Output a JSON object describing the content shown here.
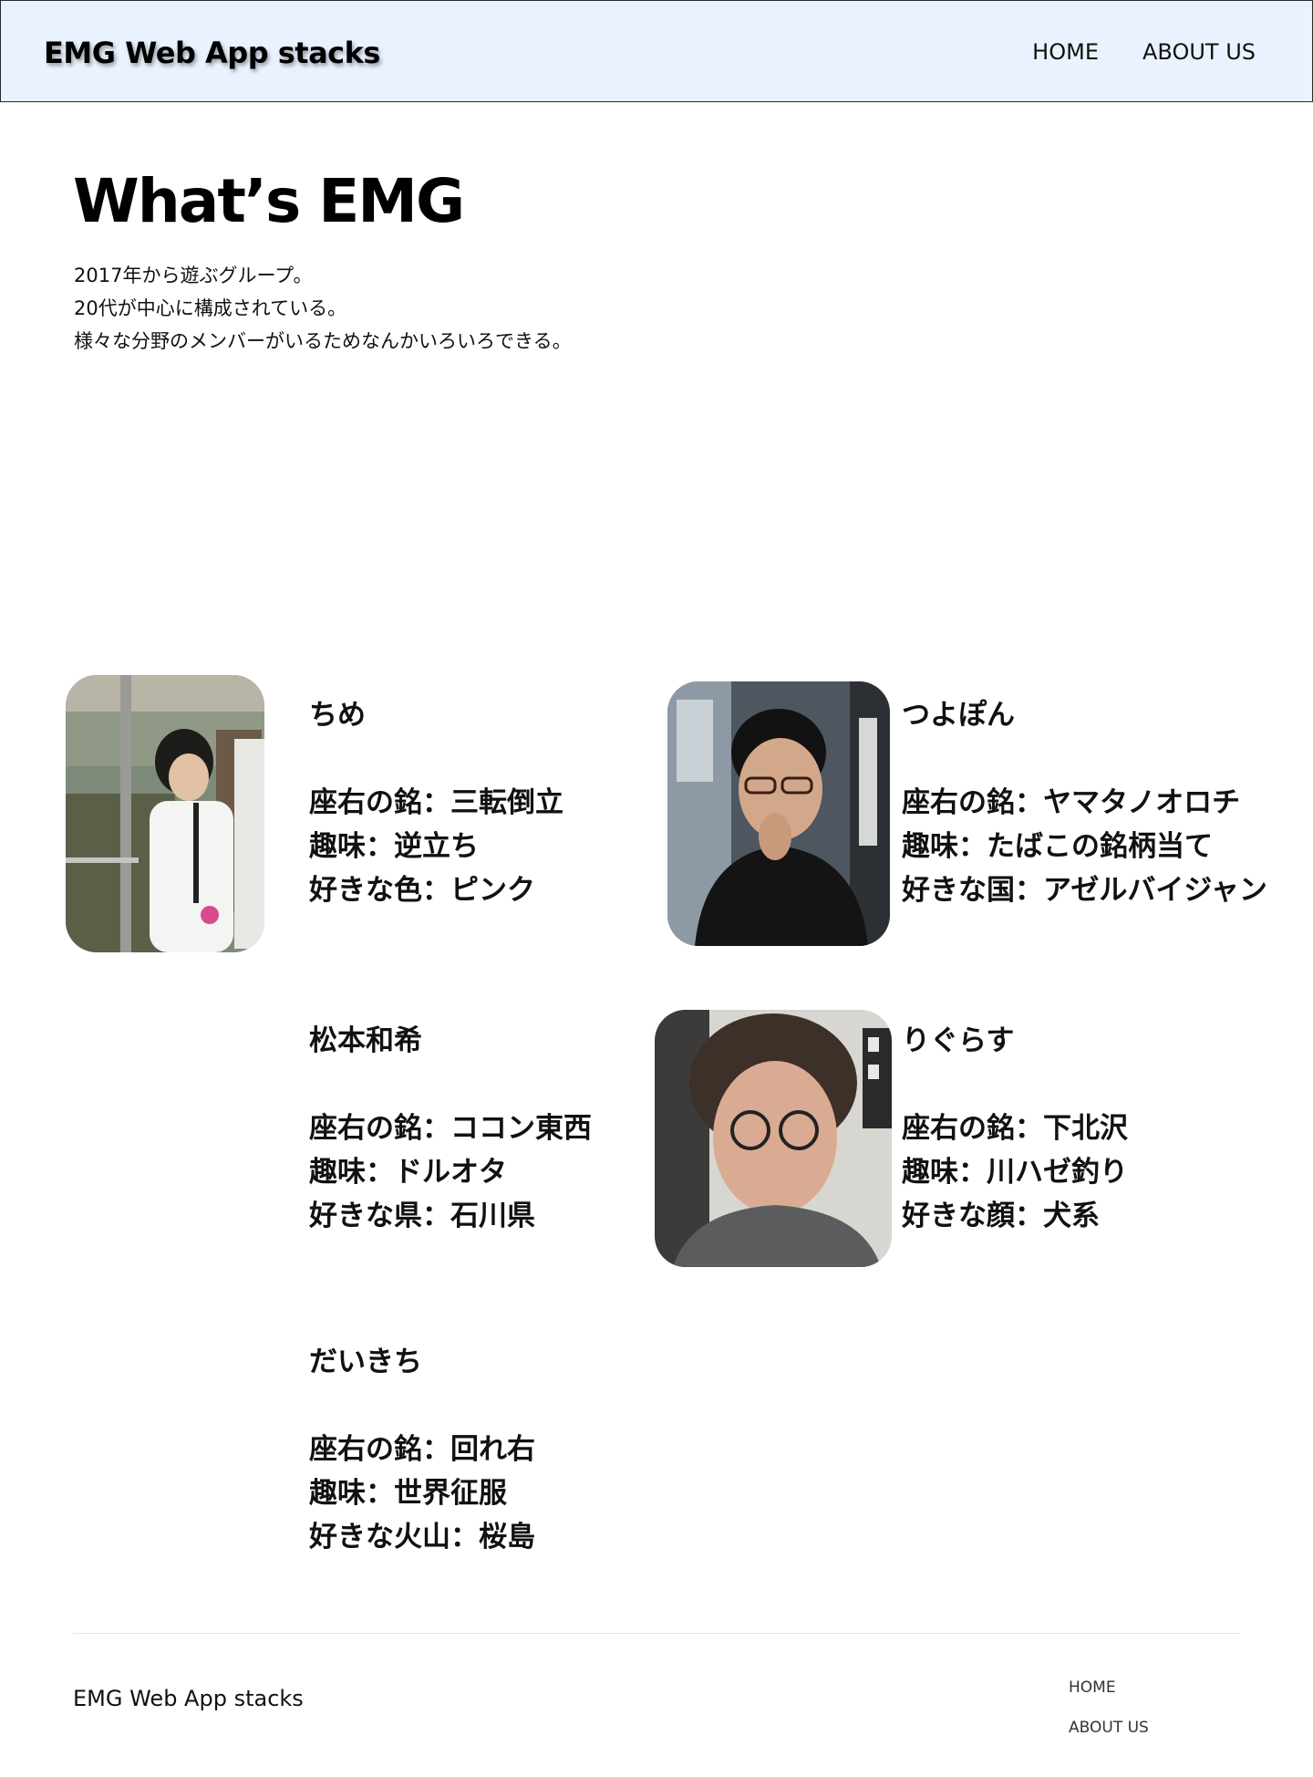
{
  "header": {
    "brand": "EMG Web App stacks",
    "nav": [
      "HOME",
      "ABOUT US"
    ]
  },
  "hero": {
    "title": "What’s EMG",
    "lines": [
      "2017年から遊ぶグループ。",
      "20代が中心に構成されている。",
      "様々な分野のメンバーがいるためなんかいろいろできる。"
    ]
  },
  "members": [
    {
      "name": "ちめ",
      "lines": [
        "座右の銘：三転倒立",
        "趣味：逆立ち",
        "好きな色：ピンク"
      ]
    },
    {
      "name": "つよぽん",
      "lines": [
        "座右の銘：ヤマタノオロチ",
        "趣味：たばこの銘柄当て",
        "好きな国：アゼルバイジャン"
      ]
    },
    {
      "name": "松本和希",
      "lines": [
        "座右の銘：ココン東西",
        "趣味：ドルオタ",
        "好きな県：石川県"
      ]
    },
    {
      "name": "りぐらす",
      "lines": [
        "座右の銘：下北沢",
        "趣味：川ハゼ釣り",
        "好きな顔：犬系"
      ]
    },
    {
      "name": "だいきち",
      "lines": [
        "座右の銘：回れ右",
        "趣味：世界征服",
        "好きな火山：桜島"
      ]
    }
  ],
  "footer": {
    "brand": "EMG Web App stacks",
    "nav": [
      "HOME",
      "ABOUT US"
    ]
  }
}
